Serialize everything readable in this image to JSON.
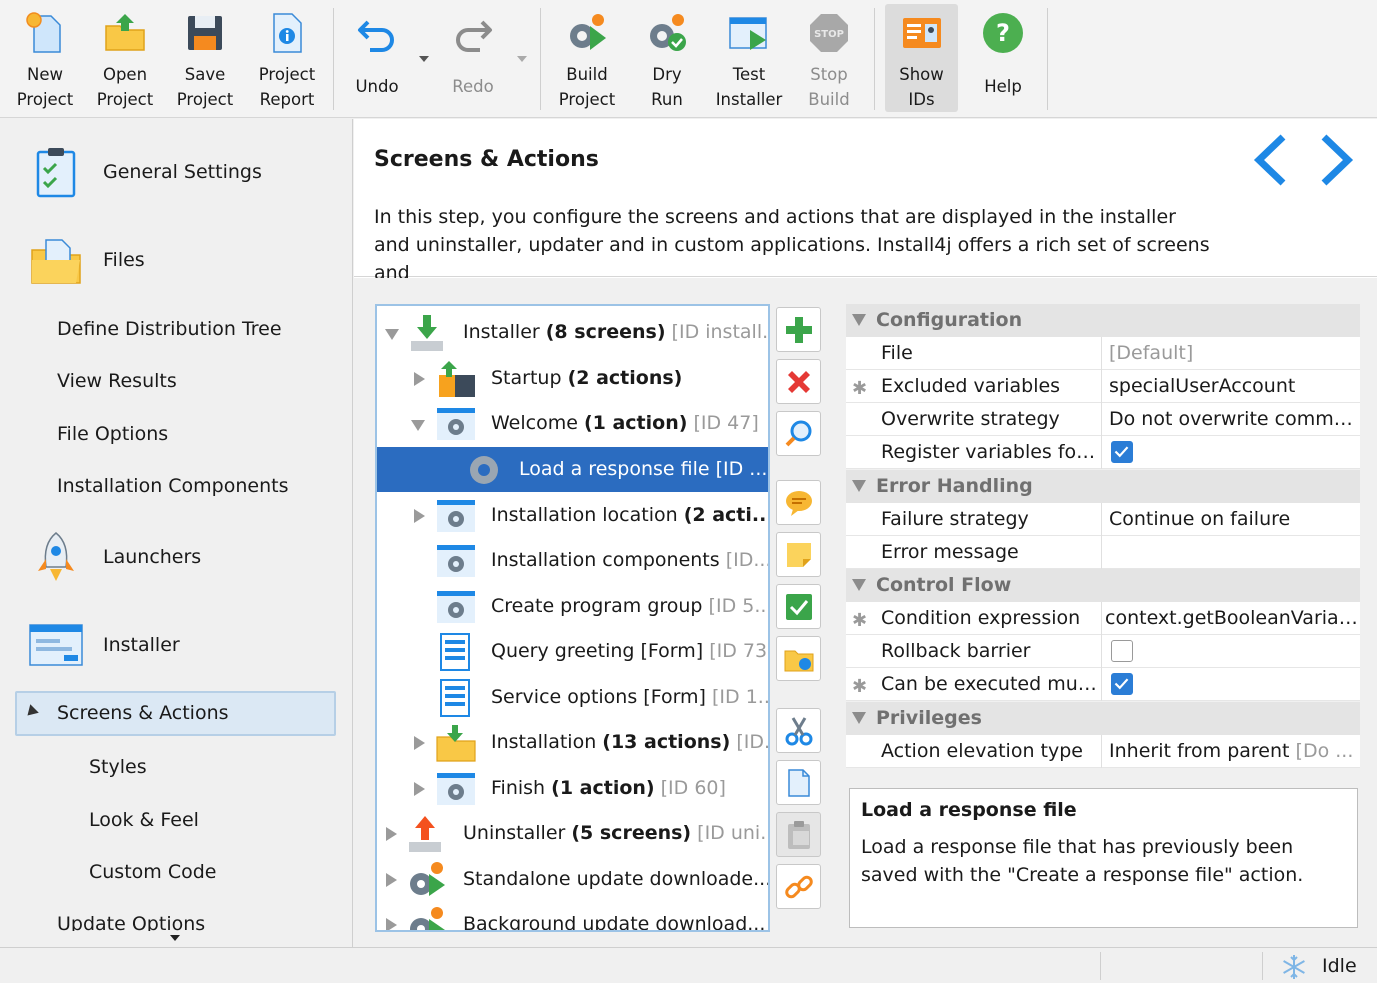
{
  "toolbar": {
    "new_project": "New\nProject",
    "open_project": "Open\nProject",
    "save_project": "Save\nProject",
    "project_report": "Project\nReport",
    "undo": "Undo",
    "redo": "Redo",
    "build_project": "Build\nProject",
    "dry_run": "Dry\nRun",
    "test_installer": "Test\nInstaller",
    "stop_build": "Stop\nBuild",
    "show_ids": "Show\nIDs",
    "help": "Help"
  },
  "sidebar": {
    "general_settings": "General Settings",
    "files": "Files",
    "define_distribution_tree": "Define Distribution Tree",
    "view_results": "View Results",
    "file_options": "File Options",
    "installation_components": "Installation Components",
    "launchers": "Launchers",
    "installer": "Installer",
    "screens_actions": "Screens & Actions",
    "styles": "Styles",
    "look_feel": "Look & Feel",
    "custom_code": "Custom Code",
    "update_options": "Update Options"
  },
  "header": {
    "title": "Screens & Actions",
    "description": "In this step, you configure the screens and actions that are displayed in the installer and uninstaller, updater and in custom applications. Install4j offers a rich set of screens and"
  },
  "tree": {
    "installer": {
      "name": "Installer ",
      "bold": "(8 screens)",
      "id": " [ID install..."
    },
    "startup": {
      "name": "Startup ",
      "bold": "(2 actions)",
      "id": ""
    },
    "welcome": {
      "name": "Welcome ",
      "bold": "(1 action)",
      "id": " [ID 47]"
    },
    "load_response": {
      "name": "Load a response file [ID ...",
      "bold": "",
      "id": ""
    },
    "installation_location": {
      "name": "Installation location ",
      "bold": "(2 acti...",
      "id": ""
    },
    "installation_components": {
      "name": "Installation components ",
      "bold": "",
      "id": "[ID..."
    },
    "create_program_group": {
      "name": "Create program group ",
      "bold": "",
      "id": "[ID 5..."
    },
    "query_greeting": {
      "name": "Query greeting [Form] ",
      "bold": "",
      "id": "[ID 73]"
    },
    "service_options": {
      "name": "Service options [Form] ",
      "bold": "",
      "id": "[ID 1..."
    },
    "installation": {
      "name": "Installation ",
      "bold": "(13 actions)",
      "id": " [ID..."
    },
    "finish": {
      "name": "Finish ",
      "bold": "(1 action)",
      "id": " [ID 60]"
    },
    "uninstaller": {
      "name": "Uninstaller ",
      "bold": "(5 screens)",
      "id": " [ID uni..."
    },
    "standalone": {
      "name": "Standalone update downloade...",
      "bold": "",
      "id": ""
    },
    "background": {
      "name": "Background update download...",
      "bold": "",
      "id": ""
    }
  },
  "properties": {
    "group_configuration": "Configuration",
    "file_key": "File",
    "file_val": "[Default]",
    "excluded_key": "Excluded variables",
    "excluded_val": "specialUserAccount",
    "overwrite_key": "Overwrite strategy",
    "overwrite_val": "Do not overwrite comma...",
    "register_key": "Register variables for ...",
    "register_checked": true,
    "group_error": "Error Handling",
    "failure_key": "Failure strategy",
    "failure_val": "Continue on failure",
    "errmsg_key": "Error message",
    "errmsg_val": "",
    "group_control": "Control Flow",
    "condition_key": "Condition expression",
    "condition_val": "context.getBooleanVariable",
    "rollback_key": "Rollback barrier",
    "rollback_checked": false,
    "multiple_key": "Can be executed mult...",
    "multiple_checked": true,
    "group_privileges": "Privileges",
    "elevation_key": "Action elevation type",
    "elevation_val": "Inherit from parent ",
    "elevation_muted": "[Do ..."
  },
  "description_box": {
    "title": "Load a response file",
    "text": "Load a response file that has previously been saved with the \"Create a response file\" action."
  },
  "status": {
    "text": "Idle"
  },
  "colors": {
    "accent": "#2b6cc0",
    "nav_arrow": "#1e88e5",
    "checkbox": "#2b7dd6"
  }
}
